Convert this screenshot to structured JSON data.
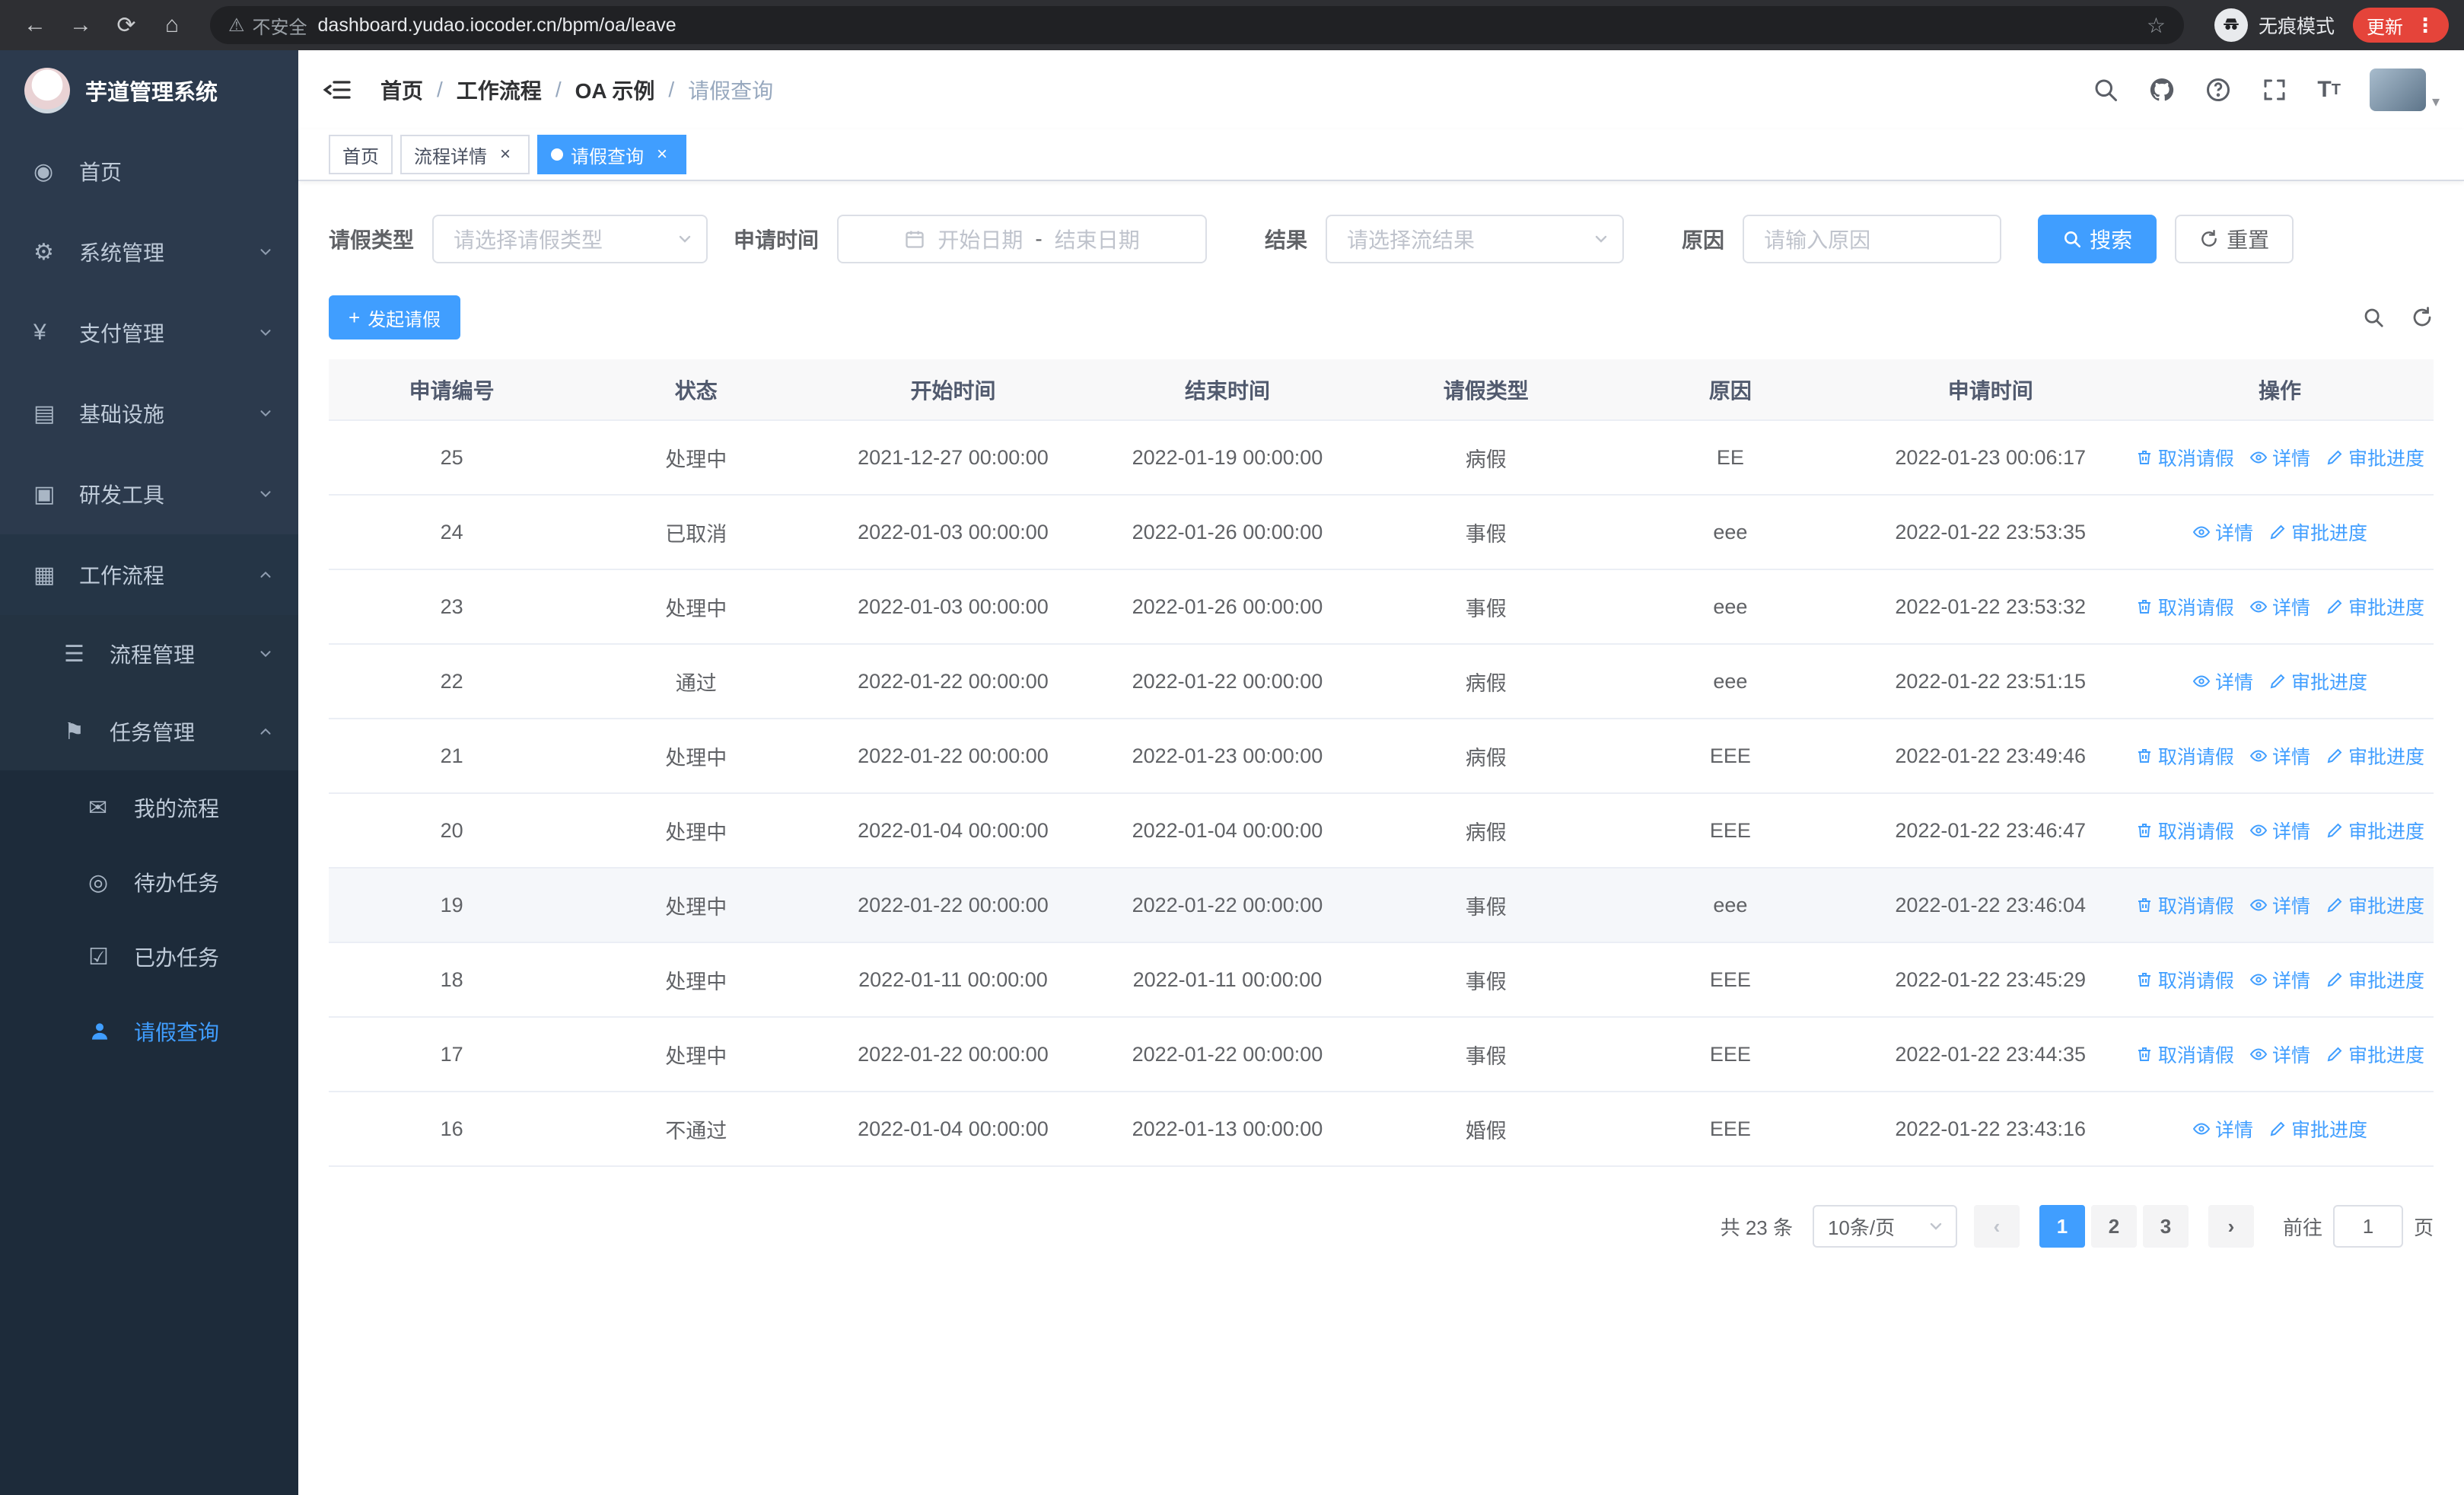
{
  "browser": {
    "security_label": "不安全",
    "url": "dashboard.yudao.iocoder.cn/bpm/oa/leave",
    "incognito_label": "无痕模式",
    "update_label": "更新"
  },
  "sidebar": {
    "app_title": "芋道管理系统",
    "items": [
      {
        "label": "首页",
        "icon": "dashboard-icon",
        "level": 1
      },
      {
        "label": "系统管理",
        "icon": "gear-icon",
        "level": 1,
        "arrow": "down"
      },
      {
        "label": "支付管理",
        "icon": "payment-icon",
        "level": 1,
        "arrow": "down"
      },
      {
        "label": "基础设施",
        "icon": "infrastructure-icon",
        "level": 1,
        "arrow": "down"
      },
      {
        "label": "研发工具",
        "icon": "devtools-icon",
        "level": 1,
        "arrow": "down"
      },
      {
        "label": "工作流程",
        "icon": "workflow-icon",
        "level": 1,
        "arrow": "up",
        "open": true
      },
      {
        "label": "流程管理",
        "icon": "process-icon",
        "level": 2,
        "arrow": "down"
      },
      {
        "label": "任务管理",
        "icon": "task-icon",
        "level": 2,
        "arrow": "up"
      },
      {
        "label": "我的流程",
        "icon": "my-process-icon",
        "level": 3
      },
      {
        "label": "待办任务",
        "icon": "todo-eye-icon",
        "level": 3
      },
      {
        "label": "已办任务",
        "icon": "done-icon",
        "level": 3
      },
      {
        "label": "请假查询",
        "icon": "user-icon",
        "level": 3,
        "active": true
      }
    ]
  },
  "header": {
    "breadcrumb": [
      "首页",
      "工作流程",
      "OA 示例",
      "请假查询"
    ]
  },
  "tabs": [
    {
      "label": "首页",
      "closable": false,
      "active": false
    },
    {
      "label": "流程详情",
      "closable": true,
      "active": false
    },
    {
      "label": "请假查询",
      "closable": true,
      "active": true
    }
  ],
  "filters": {
    "leave_type_label": "请假类型",
    "leave_type_placeholder": "请选择请假类型",
    "apply_time_label": "申请时间",
    "start_date_placeholder": "开始日期",
    "range_separator": "-",
    "end_date_placeholder": "结束日期",
    "result_label": "结果",
    "result_placeholder": "请选择流结果",
    "reason_label": "原因",
    "reason_placeholder": "请输入原因",
    "search_button": "搜索",
    "reset_button": "重置"
  },
  "toolbar": {
    "create_button": "发起请假"
  },
  "table": {
    "columns": [
      "申请编号",
      "状态",
      "开始时间",
      "结束时间",
      "请假类型",
      "原因",
      "申请时间",
      "操作"
    ],
    "action_labels": {
      "cancel": "取消请假",
      "detail": "详情",
      "progress": "审批进度"
    },
    "action_icons": {
      "cancel": "trash-icon",
      "detail": "eye-icon",
      "progress": "edit-icon"
    },
    "rows": [
      {
        "id": "25",
        "status": "处理中",
        "start": "2021-12-27 00:00:00",
        "end": "2022-01-19 00:00:00",
        "type": "病假",
        "reason": "EE",
        "applied": "2022-01-23 00:06:17",
        "actions": [
          "cancel",
          "detail",
          "progress"
        ],
        "highlight": false
      },
      {
        "id": "24",
        "status": "已取消",
        "start": "2022-01-03 00:00:00",
        "end": "2022-01-26 00:00:00",
        "type": "事假",
        "reason": "eee",
        "applied": "2022-01-22 23:53:35",
        "actions": [
          "detail",
          "progress"
        ],
        "highlight": false
      },
      {
        "id": "23",
        "status": "处理中",
        "start": "2022-01-03 00:00:00",
        "end": "2022-01-26 00:00:00",
        "type": "事假",
        "reason": "eee",
        "applied": "2022-01-22 23:53:32",
        "actions": [
          "cancel",
          "detail",
          "progress"
        ],
        "highlight": false
      },
      {
        "id": "22",
        "status": "通过",
        "start": "2022-01-22 00:00:00",
        "end": "2022-01-22 00:00:00",
        "type": "病假",
        "reason": "eee",
        "applied": "2022-01-22 23:51:15",
        "actions": [
          "detail",
          "progress"
        ],
        "highlight": false
      },
      {
        "id": "21",
        "status": "处理中",
        "start": "2022-01-22 00:00:00",
        "end": "2022-01-23 00:00:00",
        "type": "病假",
        "reason": "EEE",
        "applied": "2022-01-22 23:49:46",
        "actions": [
          "cancel",
          "detail",
          "progress"
        ],
        "highlight": false
      },
      {
        "id": "20",
        "status": "处理中",
        "start": "2022-01-04 00:00:00",
        "end": "2022-01-04 00:00:00",
        "type": "病假",
        "reason": "EEE",
        "applied": "2022-01-22 23:46:47",
        "actions": [
          "cancel",
          "detail",
          "progress"
        ],
        "highlight": false
      },
      {
        "id": "19",
        "status": "处理中",
        "start": "2022-01-22 00:00:00",
        "end": "2022-01-22 00:00:00",
        "type": "事假",
        "reason": "eee",
        "applied": "2022-01-22 23:46:04",
        "actions": [
          "cancel",
          "detail",
          "progress"
        ],
        "highlight": true
      },
      {
        "id": "18",
        "status": "处理中",
        "start": "2022-01-11 00:00:00",
        "end": "2022-01-11 00:00:00",
        "type": "事假",
        "reason": "EEE",
        "applied": "2022-01-22 23:45:29",
        "actions": [
          "cancel",
          "detail",
          "progress"
        ],
        "highlight": false
      },
      {
        "id": "17",
        "status": "处理中",
        "start": "2022-01-22 00:00:00",
        "end": "2022-01-22 00:00:00",
        "type": "事假",
        "reason": "EEE",
        "applied": "2022-01-22 23:44:35",
        "actions": [
          "cancel",
          "detail",
          "progress"
        ],
        "highlight": false
      },
      {
        "id": "16",
        "status": "不通过",
        "start": "2022-01-04 00:00:00",
        "end": "2022-01-13 00:00:00",
        "type": "婚假",
        "reason": "EEE",
        "applied": "2022-01-22 23:43:16",
        "actions": [
          "detail",
          "progress"
        ],
        "highlight": false
      }
    ]
  },
  "pagination": {
    "total": "共 23 条",
    "page_size": "10条/页",
    "pages": [
      "1",
      "2",
      "3"
    ],
    "active_page": "1",
    "goto_label": "前往",
    "goto_value": "1",
    "goto_unit": "页"
  }
}
